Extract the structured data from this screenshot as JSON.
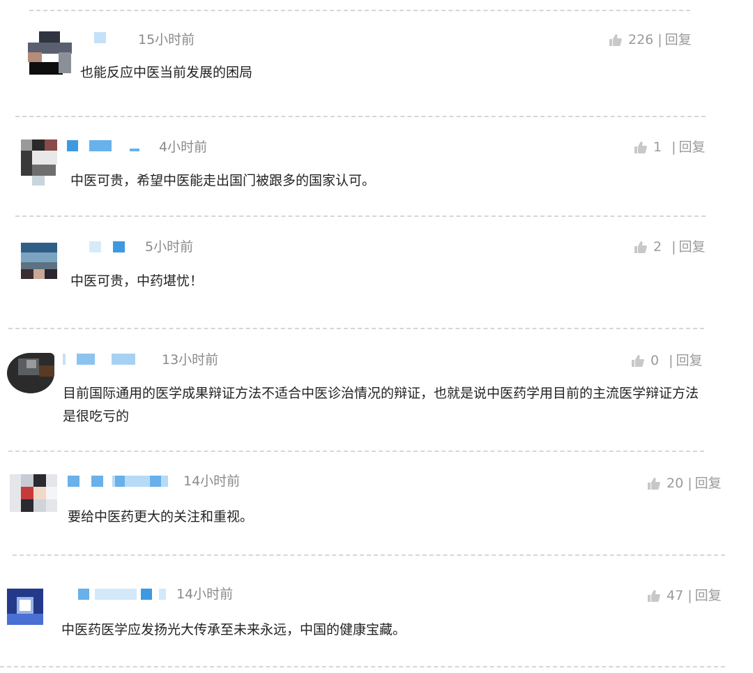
{
  "comments": [
    {
      "time": "15小时前",
      "likes": "226",
      "sep": "|",
      "reply": "回复",
      "text": "也能反应中医当前发展的困局"
    },
    {
      "time": "4小时前",
      "likes": "1",
      "sep": "|",
      "reply": "回复",
      "text": "中医可贵，希望中医能走出国门被跟多的国家认可。"
    },
    {
      "time": "5小时前",
      "likes": "2",
      "sep": "|",
      "reply": "回复",
      "text": "中医可贵，中药堪忧！"
    },
    {
      "time": "13小时前",
      "likes": "0",
      "sep": "|",
      "reply": "回复",
      "text": "目前国际通用的医学成果辩证方法不适合中医诊治情况的辩证，也就是说中医药学用目前的主流医学辩证方法是很吃亏的"
    },
    {
      "time": "14小时前",
      "likes": "20",
      "sep": "|",
      "reply": "回复",
      "text": "要给中医药更大的关注和重视。"
    },
    {
      "time": "14小时前",
      "likes": "47",
      "sep": "|",
      "reply": "回复",
      "text": "中医药医学应发扬光大传承至未来永远，中国的健康宝藏。"
    }
  ],
  "icons": {
    "like": "thumbs-up-icon"
  },
  "colors": {
    "accent": "#4aa3e8",
    "text": "#222222",
    "muted": "#8a8a8a"
  }
}
